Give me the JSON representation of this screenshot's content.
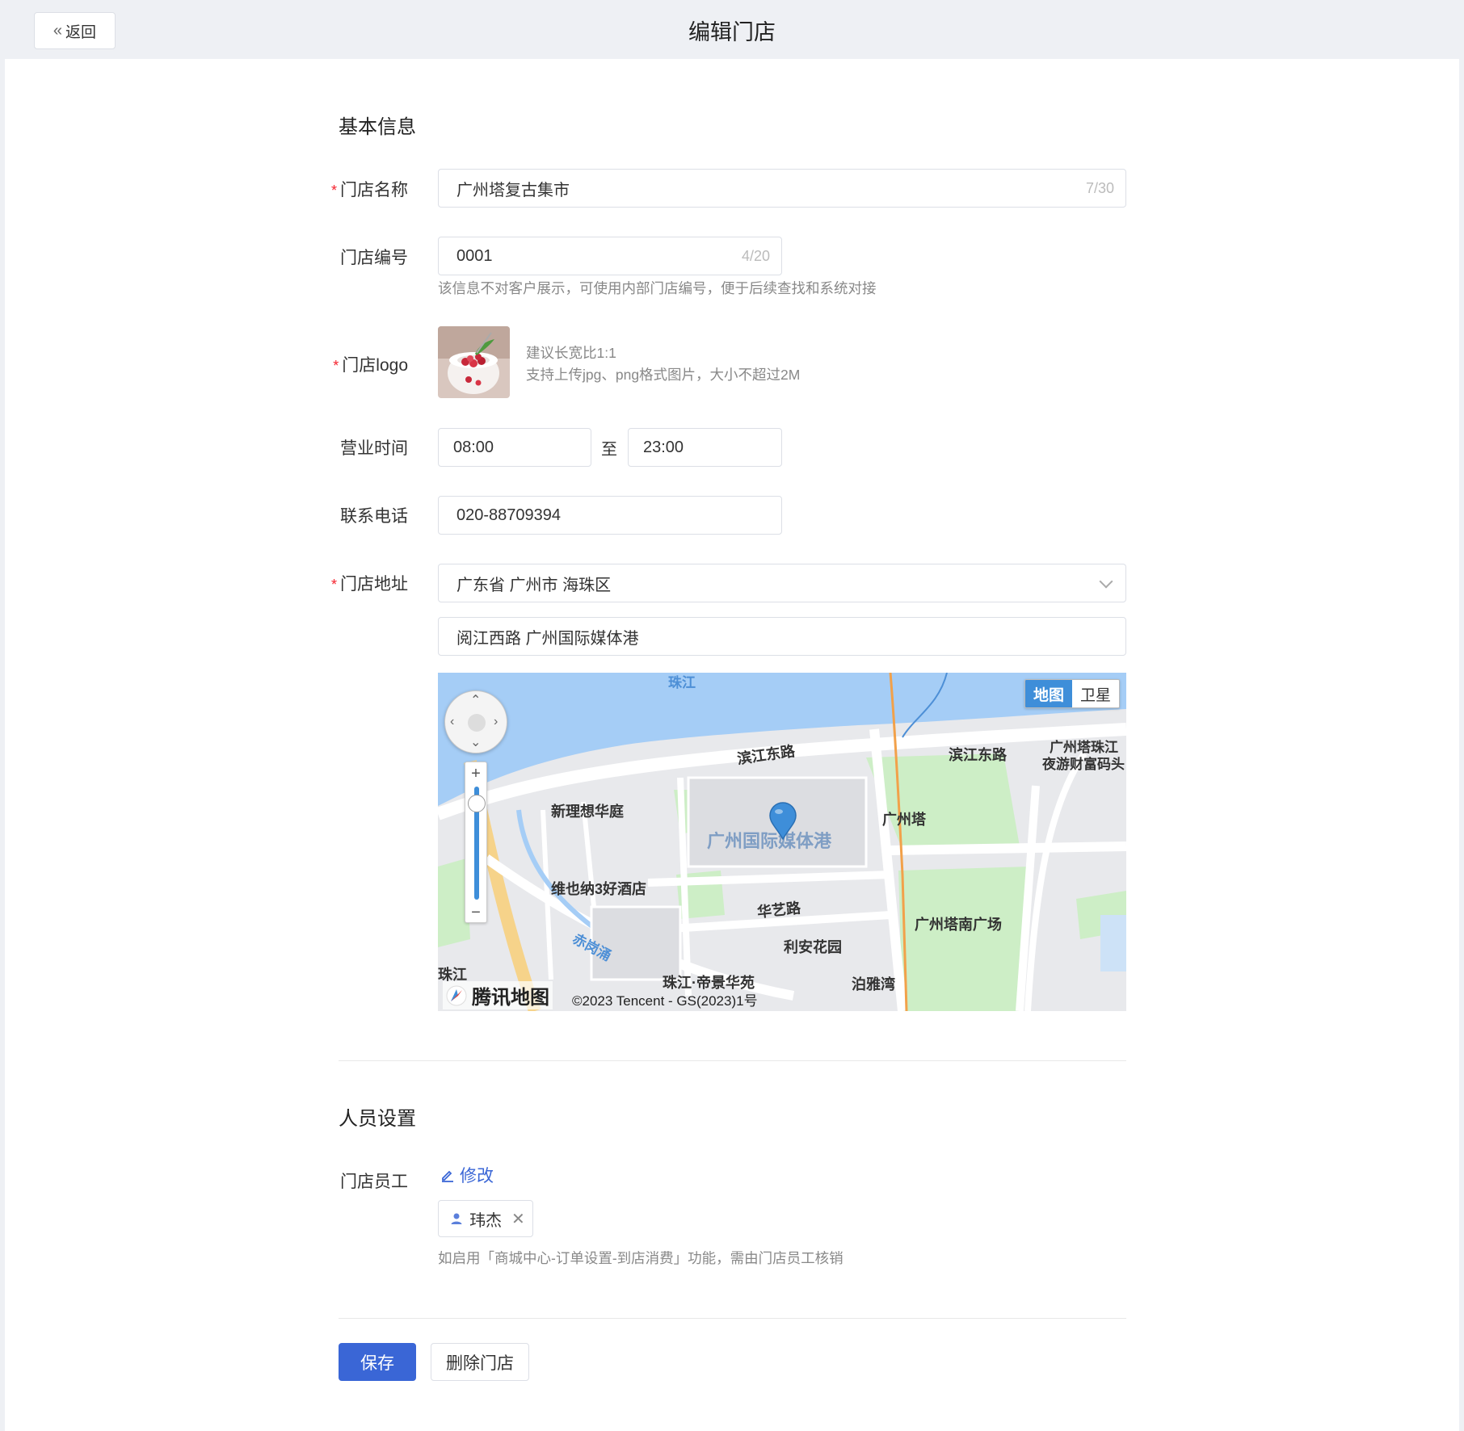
{
  "header": {
    "back_label": "返回",
    "title": "编辑门店"
  },
  "basic": {
    "section_title": "基本信息",
    "name": {
      "label": "门店名称",
      "value": "广州塔复古集市",
      "count": "7/30"
    },
    "code": {
      "label": "门店编号",
      "value": "0001",
      "count": "4/20",
      "hint": "该信息不对客户展示，可使用内部门店编号，便于后续查找和系统对接"
    },
    "logo": {
      "label": "门店logo",
      "hint_ratio": "建议长宽比1:1",
      "hint_format": "支持上传jpg、png格式图片，大小不超过2M"
    },
    "hours": {
      "label": "营业时间",
      "start": "08:00",
      "separator": "至",
      "end": "23:00"
    },
    "phone": {
      "label": "联系电话",
      "value": "020-88709394"
    },
    "address": {
      "label": "门店地址",
      "region": "广东省 广州市 海珠区",
      "detail": "阅江西路 广州国际媒体港"
    }
  },
  "map": {
    "switch_map": "地图",
    "switch_satellite": "卫星",
    "brand": "腾讯地图",
    "copyright": "©2023 Tencent - GS(2023)1号",
    "labels": {
      "river_top": "珠江",
      "road1": "滨江东路",
      "road2": "滨江东路",
      "pier": "广州塔珠江",
      "pier2": "夜游财富码头",
      "poi1": "新理想华庭",
      "poi_main": "广州国际媒体港",
      "tower": "广州塔",
      "hotel": "维也纳3好酒店",
      "road3": "华艺路",
      "square": "广州塔南广场",
      "garden": "利安花园",
      "creek": "赤岗涌",
      "estate": "珠江·帝景华苑",
      "bay": "泊雅湾",
      "edge_left": "珠江"
    },
    "colors": {
      "water": "#a5cdf6",
      "green": "#cdeec6",
      "road": "#ffffff",
      "pin": "#3e8ed9"
    }
  },
  "staff": {
    "section_title": "人员设置",
    "label": "门店员工",
    "edit_label": "修改",
    "member": "玮杰",
    "hint": "如启用「商城中心-订单设置-到店消费」功能，需由门店员工核销"
  },
  "actions": {
    "save": "保存",
    "delete": "删除门店"
  },
  "theme": {
    "primary": "#3a66d6",
    "required": "#f5222d"
  }
}
